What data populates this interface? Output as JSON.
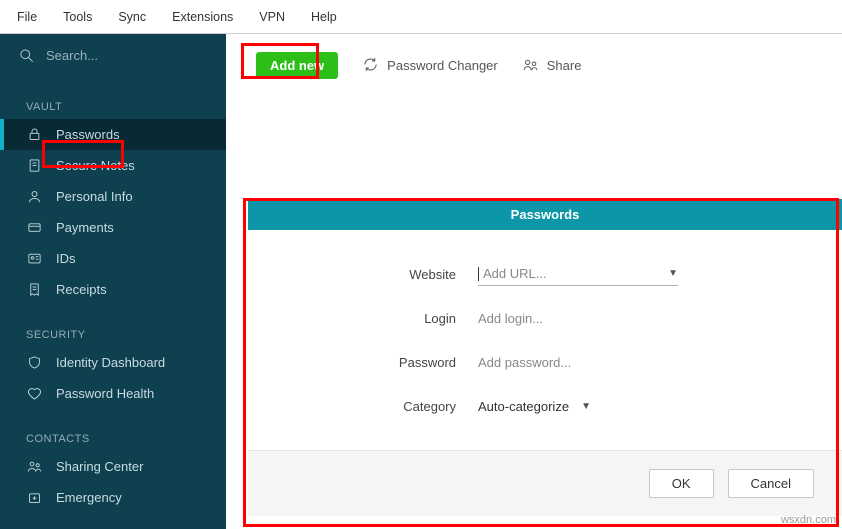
{
  "menubar": [
    "File",
    "Tools",
    "Sync",
    "Extensions",
    "VPN",
    "Help"
  ],
  "search": {
    "placeholder": "Search..."
  },
  "sidebar": {
    "sections": [
      {
        "title": "VAULT",
        "items": [
          {
            "label": "Passwords",
            "icon": "lock",
            "active": true
          },
          {
            "label": "Secure Notes",
            "icon": "note"
          },
          {
            "label": "Personal Info",
            "icon": "person"
          },
          {
            "label": "Payments",
            "icon": "card"
          },
          {
            "label": "IDs",
            "icon": "id"
          },
          {
            "label": "Receipts",
            "icon": "receipt"
          }
        ]
      },
      {
        "title": "SECURITY",
        "items": [
          {
            "label": "Identity Dashboard",
            "icon": "shield"
          },
          {
            "label": "Password Health",
            "icon": "heart"
          }
        ]
      },
      {
        "title": "CONTACTS",
        "items": [
          {
            "label": "Sharing Center",
            "icon": "people"
          },
          {
            "label": "Emergency",
            "icon": "plus"
          }
        ]
      }
    ]
  },
  "toolbar": {
    "add_new": "Add new",
    "password_changer": "Password Changer",
    "share": "Share"
  },
  "dialog": {
    "title": "Passwords",
    "fields": {
      "website": {
        "label": "Website",
        "placeholder": "Add URL..."
      },
      "login": {
        "label": "Login",
        "placeholder": "Add login..."
      },
      "password": {
        "label": "Password",
        "placeholder": "Add password..."
      },
      "category": {
        "label": "Category",
        "value": "Auto-categorize"
      }
    },
    "buttons": {
      "ok": "OK",
      "cancel": "Cancel"
    }
  },
  "watermark": "wsxdn.com"
}
